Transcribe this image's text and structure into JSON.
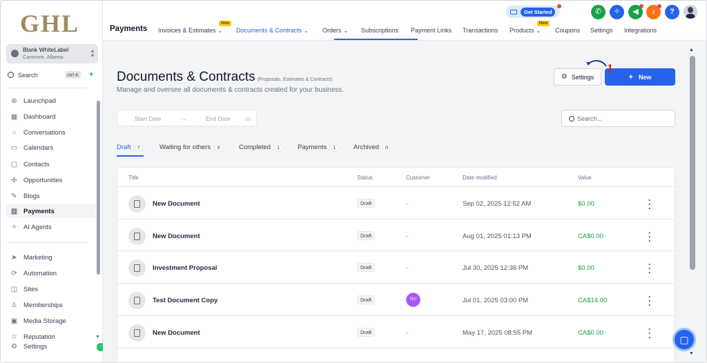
{
  "brand": {
    "logo_text": "GHL"
  },
  "account": {
    "name": "Blank WhiteLabel",
    "location": "Canmore, Alberta"
  },
  "sidebar": {
    "search_label": "Search",
    "search_shortcut": "ctrl K",
    "items": [
      {
        "label": "Launchpad",
        "icon": "rocket-icon"
      },
      {
        "label": "Dashboard",
        "icon": "grid-icon"
      },
      {
        "label": "Conversations",
        "icon": "chat-icon"
      },
      {
        "label": "Calendars",
        "icon": "calendar-icon"
      },
      {
        "label": "Contacts",
        "icon": "contacts-icon"
      },
      {
        "label": "Opportunities",
        "icon": "opportunities-icon"
      },
      {
        "label": "Blogs",
        "icon": "blog-icon"
      },
      {
        "label": "Payments",
        "icon": "payments-icon",
        "active": true
      },
      {
        "label": "AI Agents",
        "icon": "sparkle-icon"
      },
      {
        "label": "Marketing",
        "icon": "send-icon"
      },
      {
        "label": "Automation",
        "icon": "automation-icon"
      },
      {
        "label": "Sites",
        "icon": "sites-icon"
      },
      {
        "label": "Memberships",
        "icon": "membership-icon"
      },
      {
        "label": "Media Storage",
        "icon": "image-icon"
      },
      {
        "label": "Reputation",
        "icon": "reputation-icon"
      },
      {
        "label": "Settings",
        "icon": "gear-icon"
      }
    ]
  },
  "header": {
    "section_title": "Payments",
    "tabs": [
      {
        "label": "Invoices & Estimates",
        "dropdown": true,
        "badge": "New"
      },
      {
        "label": "Documents & Contracts",
        "dropdown": true,
        "active": true
      },
      {
        "label": "Orders",
        "dropdown": true
      },
      {
        "label": "Subscriptions"
      },
      {
        "label": "Payment Links"
      },
      {
        "label": "Transactions"
      },
      {
        "label": "Products",
        "dropdown": true,
        "badge": "New"
      },
      {
        "label": "Coupons"
      },
      {
        "label": "Settings"
      },
      {
        "label": "Integrations"
      }
    ],
    "get_started": "Get Started",
    "help_label": "?"
  },
  "page": {
    "title": "Documents & Contracts",
    "title_note": "(Proposals, Estimates & Contracts)",
    "subtitle": "Manage and oversee all documents & contracts created for your business.",
    "settings_button": "Settings",
    "new_button": "New",
    "annotation_marker": "1",
    "start_date_placeholder": "Start Date",
    "end_date_placeholder": "End Date",
    "search_placeholder": "Search...",
    "filter_tabs": [
      {
        "label": "Draft",
        "count": "7",
        "active": true
      },
      {
        "label": "Waiting for others",
        "count": "3"
      },
      {
        "label": "Completed",
        "count": "1"
      },
      {
        "label": "Payments",
        "count": "1"
      },
      {
        "label": "Archived",
        "count": "0"
      }
    ],
    "columns": [
      "Title",
      "Status",
      "Customer",
      "Date modified",
      "Value"
    ],
    "rows": [
      {
        "title": "New Document",
        "status": "Draft",
        "customer": "-",
        "date": "Sep 02, 2025 12:52 AM",
        "value": "$0.00"
      },
      {
        "title": "New Document",
        "status": "Draft",
        "customer": "-",
        "date": "Aug 01, 2025 01:13 PM",
        "value": "CA$0.00"
      },
      {
        "title": "Investment Proposal",
        "status": "Draft",
        "customer": "-",
        "date": "Jul 30, 2025 12:36 PM",
        "value": "$0.00"
      },
      {
        "title": "Test Document Copy",
        "status": "Draft",
        "customer": "NU",
        "date": "Jul 01, 2025 03:00 PM",
        "value": "CA$14.00"
      },
      {
        "title": "New Document",
        "status": "Draft",
        "customer": "-",
        "date": "May 17, 2025 08:55 PM",
        "value": "CA$0.00"
      }
    ]
  },
  "colors": {
    "accent": "#2563eb",
    "value_green": "#16a34a",
    "brand_gold": "#a08c63"
  }
}
